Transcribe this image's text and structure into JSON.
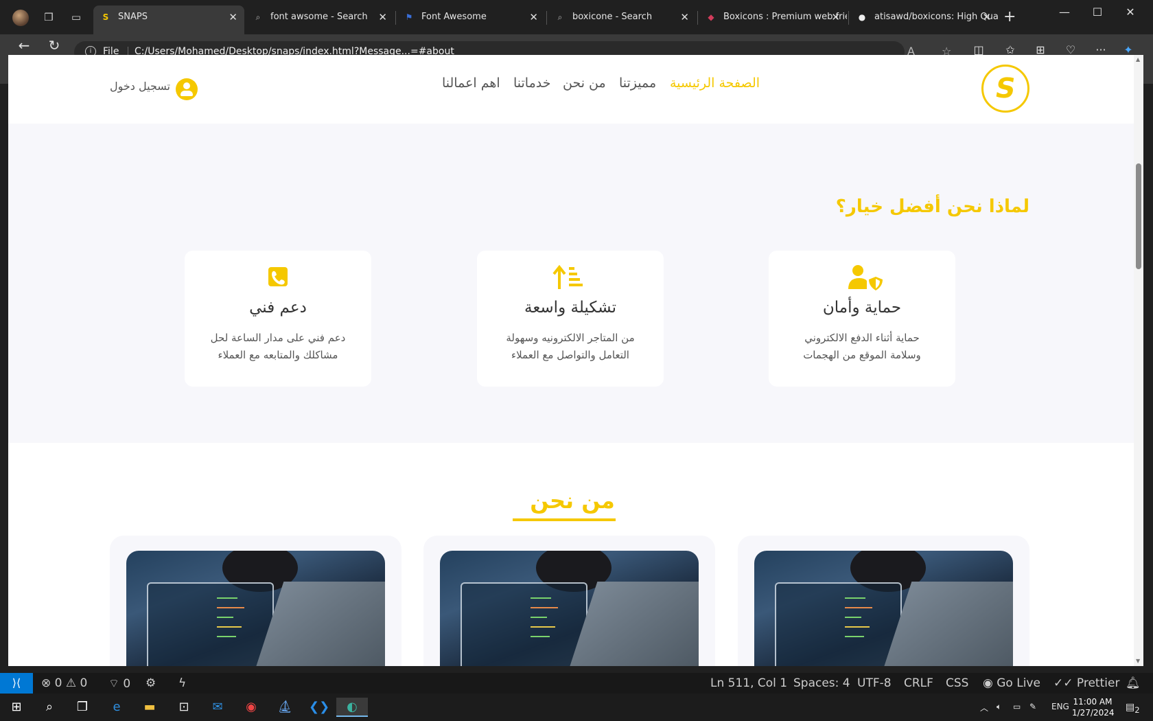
{
  "browser": {
    "tabs": [
      {
        "title": "SNAPS",
        "icon": "snaps-logo-icon",
        "active": true
      },
      {
        "title": "font awsome - Search",
        "icon": "search-icon"
      },
      {
        "title": "Font Awesome",
        "icon": "flag-icon"
      },
      {
        "title": "boxicone - Search",
        "icon": "search-icon"
      },
      {
        "title": "Boxicons : Premium web frien",
        "icon": "boxicons-icon"
      },
      {
        "title": "atisawd/boxicons: High Qual",
        "icon": "github-icon"
      }
    ],
    "file_label": "File",
    "url": "C:/Users/Mohamed/Desktop/snaps/index.html?Message...=#about"
  },
  "site": {
    "nav": [
      "الصفحة الرئيسية",
      "مميزتنا",
      "من نحن",
      "خدماتنا",
      "اهم اعمالنا"
    ],
    "login": "تسجيل دخول",
    "accent": "#f5c800",
    "features": {
      "title": "لماذا نحن أفضل خيار؟",
      "cards": [
        {
          "icon": "user-shield-icon",
          "title": "حماية وأمان",
          "line1": "حماية أثناء الدفع الالكتروني",
          "line2": "وسلامة الموقع من الهجمات"
        },
        {
          "icon": "sort-amount-icon",
          "title": "تشكيلة واسعة",
          "line1": "من المتاجر الالكترونيه وسهولة",
          "line2": "التعامل والتواصل مع العملاء"
        },
        {
          "icon": "phone-icon",
          "title": "دعم فني",
          "line1": "دعم فني على مدار الساعة لحل",
          "line2": "مشاكلك والمتابعه مع العملاء"
        }
      ]
    },
    "about": {
      "title": "من نحن"
    }
  },
  "statusbar": {
    "errors": "0",
    "warnings": "0",
    "ports": "0",
    "position": "Ln 511, Col 1",
    "spaces": "Spaces: 4",
    "encoding": "UTF-8",
    "eol": "CRLF",
    "language": "CSS",
    "golive": "Go Live",
    "prettier": "Prettier"
  },
  "taskbar": {
    "lang": "ENG",
    "time": "11:00 AM",
    "date": "1/27/2024",
    "notifications": "2"
  }
}
